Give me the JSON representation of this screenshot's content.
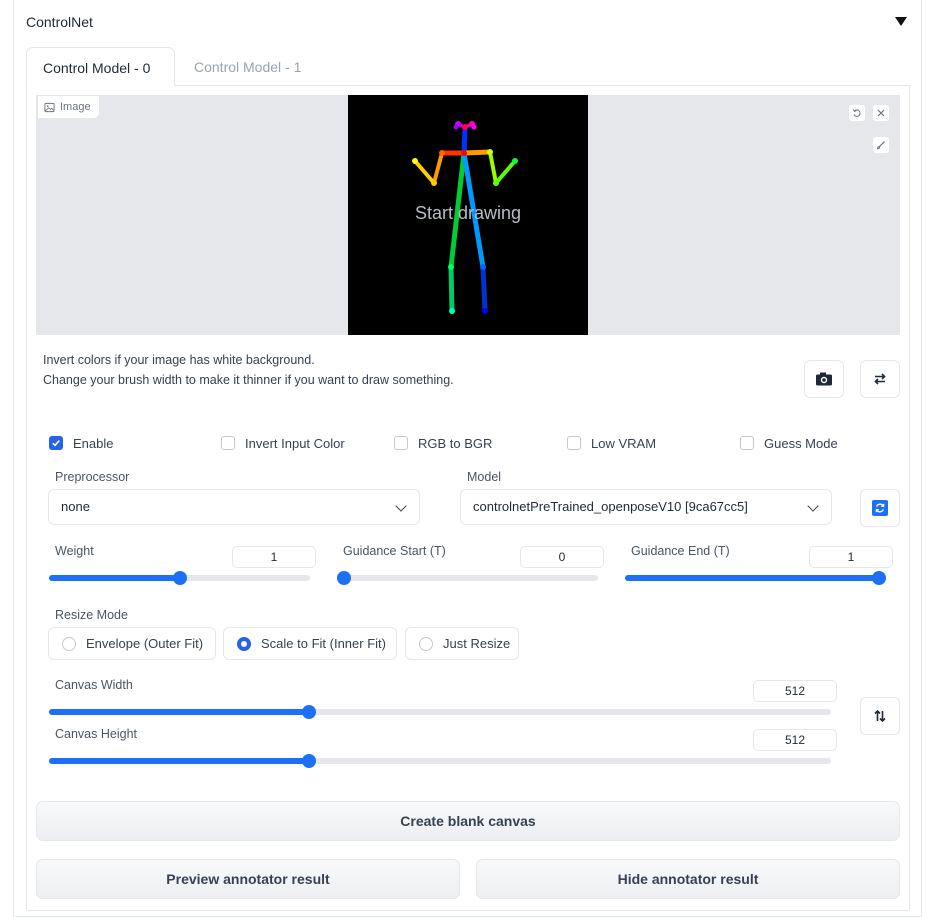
{
  "section": {
    "title": "ControlNet"
  },
  "tabs": [
    {
      "label": "Control Model - 0"
    },
    {
      "label": "Control Model - 1"
    }
  ],
  "image": {
    "label": "Image",
    "overlay_text": "Start drawing"
  },
  "hints": [
    "Invert colors if your image has white background.",
    "Change your brush width to make it thinner if you want to draw something."
  ],
  "checkboxes": [
    {
      "label": "Enable",
      "checked": true
    },
    {
      "label": "Invert Input Color",
      "checked": false
    },
    {
      "label": "RGB to BGR",
      "checked": false
    },
    {
      "label": "Low VRAM",
      "checked": false
    },
    {
      "label": "Guess Mode",
      "checked": false
    }
  ],
  "preprocessor": {
    "label": "Preprocessor",
    "value": "none"
  },
  "model": {
    "label": "Model",
    "value": "controlnetPreTrained_openposeV10 [9ca67cc5]"
  },
  "sliders": {
    "weight": {
      "label": "Weight",
      "value": "1",
      "fraction": 0.5
    },
    "guidance_start": {
      "label": "Guidance Start (T)",
      "value": "0",
      "fraction": 0
    },
    "guidance_end": {
      "label": "Guidance End (T)",
      "value": "1",
      "fraction": 1
    },
    "canvas_width": {
      "label": "Canvas Width",
      "value": "512",
      "fraction": 0.33
    },
    "canvas_height": {
      "label": "Canvas Height",
      "value": "512",
      "fraction": 0.33
    }
  },
  "resize_mode": {
    "label": "Resize Mode",
    "options": [
      {
        "label": "Envelope (Outer Fit)",
        "selected": false
      },
      {
        "label": "Scale to Fit (Inner Fit)",
        "selected": true
      },
      {
        "label": "Just Resize",
        "selected": false
      }
    ]
  },
  "buttons": {
    "create_blank": "Create blank canvas",
    "preview": "Preview annotator result",
    "hide": "Hide annotator result"
  },
  "colors": {
    "accent": "#1d70f5",
    "checkbox": "#2563eb",
    "refresh_button": "#1d70f5"
  }
}
